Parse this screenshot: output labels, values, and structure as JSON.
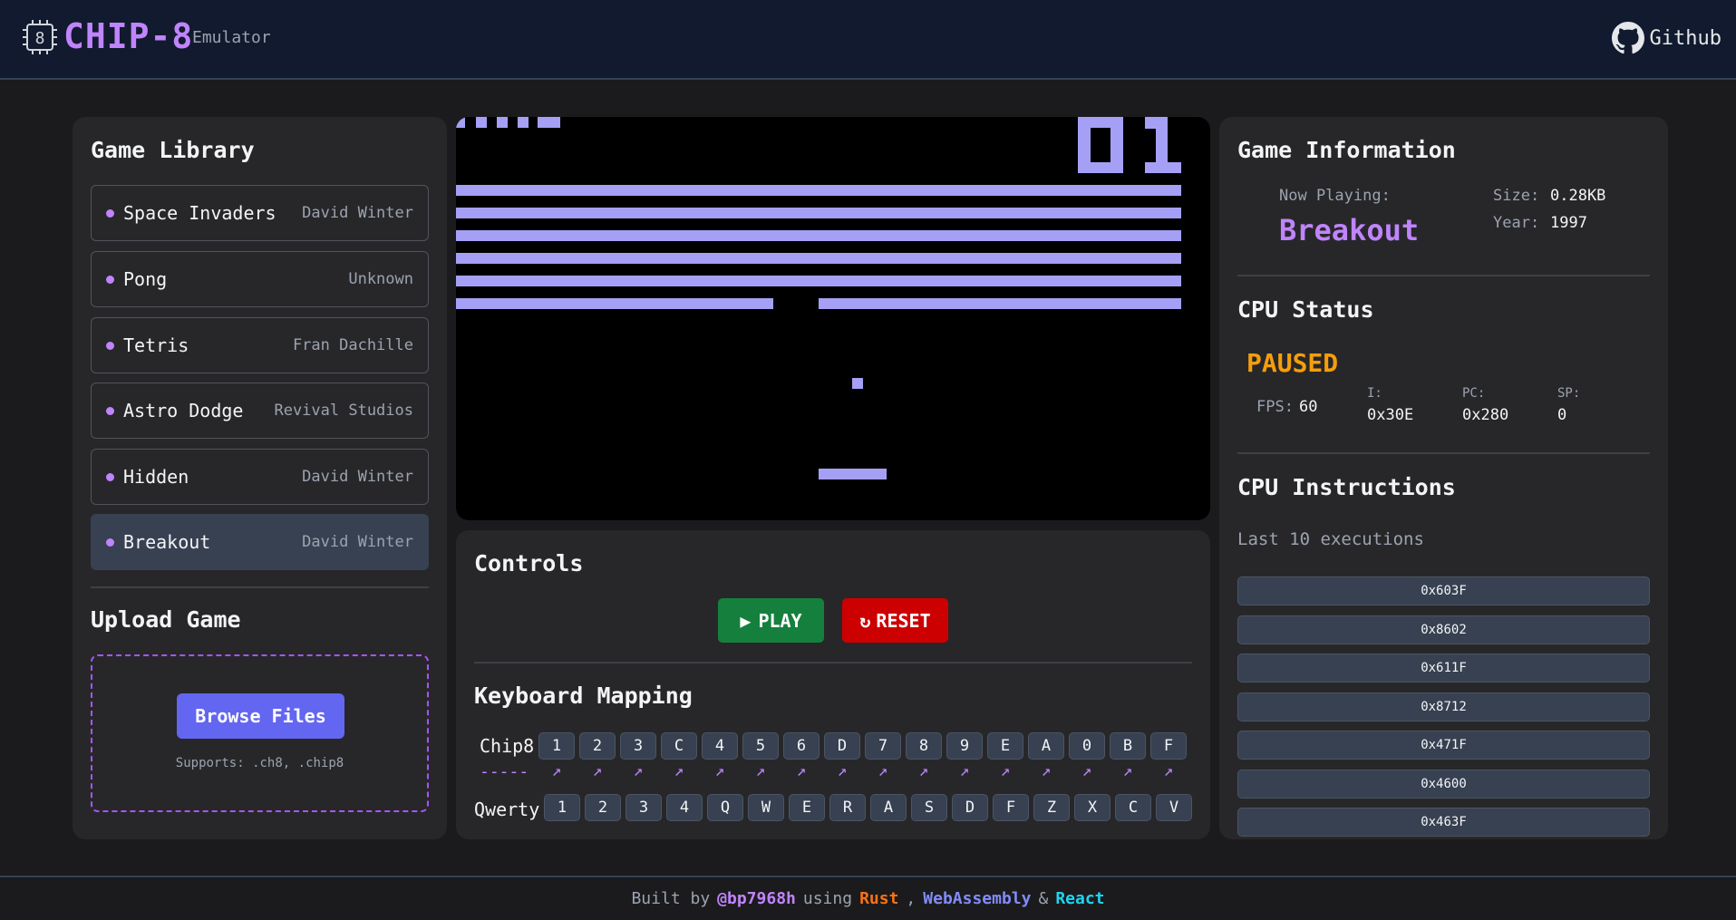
{
  "header": {
    "chip_icon_text": "8",
    "title": "CHIP-8",
    "subtitle": "Emulator",
    "github_label": "Github"
  },
  "library": {
    "title": "Game Library",
    "items": [
      {
        "name": "Space Invaders",
        "author": "David Winter"
      },
      {
        "name": "Pong",
        "author": "Unknown"
      },
      {
        "name": "Tetris",
        "author": "Fran Dachille"
      },
      {
        "name": "Astro Dodge",
        "author": "Revival Studios"
      },
      {
        "name": "Hidden",
        "author": "David Winter"
      },
      {
        "name": "Breakout",
        "author": "David Winter"
      }
    ],
    "selected": "Breakout"
  },
  "upload": {
    "title": "Upload Game",
    "browse_label": "Browse Files",
    "supports": "Supports: .ch8, .chip8"
  },
  "screen": {
    "score": "01",
    "colors": {
      "pixel": "#a5a0f5",
      "background": "#000000"
    }
  },
  "controls": {
    "title": "Controls",
    "play_label": "PLAY",
    "reset_label": "RESET",
    "keyboard_title": "Keyboard Mapping",
    "chip8_label": "Chip8",
    "chip8_separator": "-----",
    "qwerty_label": "Qwerty",
    "chip8_keys": [
      "1",
      "2",
      "3",
      "C",
      "4",
      "5",
      "6",
      "D",
      "7",
      "8",
      "9",
      "E",
      "A",
      "0",
      "B",
      "F"
    ],
    "qwerty_keys": [
      "1",
      "2",
      "3",
      "4",
      "Q",
      "W",
      "E",
      "R",
      "A",
      "S",
      "D",
      "F",
      "Z",
      "X",
      "C",
      "V"
    ]
  },
  "game_info": {
    "title": "Game Information",
    "now_playing_label": "Now Playing:",
    "now_playing": "Breakout",
    "size_label": "Size:",
    "size": "0.28KB",
    "year_label": "Year:",
    "year": "1997"
  },
  "cpu_status": {
    "title": "CPU Status",
    "state": "PAUSED",
    "fps_label": "FPS:",
    "fps": "60",
    "i_label": "I:",
    "i": "0x30E",
    "pc_label": "PC:",
    "pc": "0x280",
    "sp_label": "SP:",
    "sp": "0"
  },
  "cpu_instructions": {
    "title": "CPU Instructions",
    "subtitle": "Last 10 executions",
    "items": [
      "0x603F",
      "0x8602",
      "0x611F",
      "0x8712",
      "0x471F",
      "0x4600",
      "0x463F"
    ]
  },
  "footer": {
    "built_by": "Built by",
    "handle": "@bp7968h",
    "using": "using",
    "rust": "Rust",
    "comma": ",",
    "wasm": "WebAssembly",
    "amp": "&",
    "react": "React"
  }
}
